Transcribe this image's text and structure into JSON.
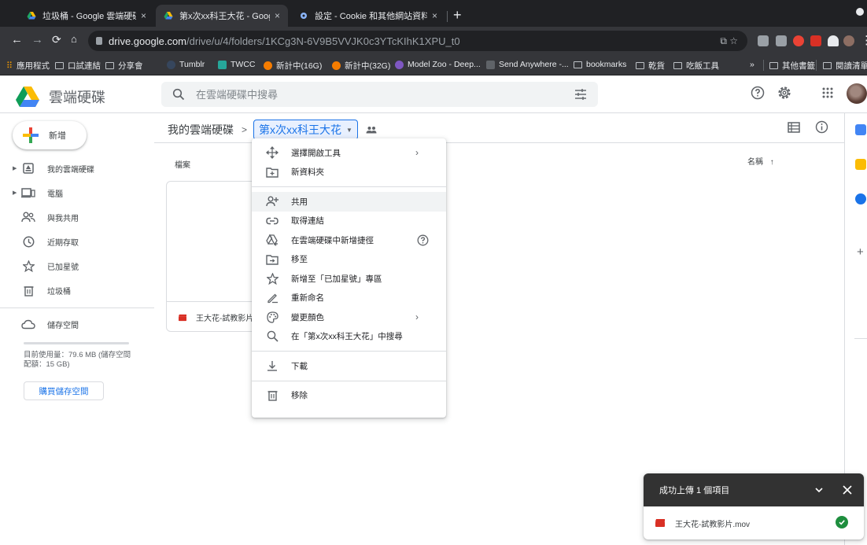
{
  "browser": {
    "tabs": [
      {
        "title": "垃圾桶 - Google 雲端硬碟",
        "close": "×"
      },
      {
        "title": "第x次xx科王大花 - Google 雲端",
        "close": "×"
      },
      {
        "title": "設定 - Cookie 和其他網站資料",
        "close": "×"
      }
    ],
    "new_tab": "+",
    "url_host": "drive.google.com",
    "url_path": "/drive/u/4/folders/1KCg3N-6V9B5VVJK0c3YTcKIhK1XPU_t0",
    "url_actions": "⧉  ☆"
  },
  "bookmarks": {
    "items": [
      "應用程式",
      "口試連結",
      "分享會",
      "Tumblr",
      "TWCC",
      "新計中(16G)",
      "新計中(32G)",
      "Model Zoo - Deep...",
      "Send Anywhere -...",
      "bookmarks",
      "乾貨",
      "吃飯工具"
    ],
    "more": "»",
    "other": "其他書籤",
    "reading": "閱讀清單"
  },
  "header": {
    "app_name": "雲端硬碟",
    "search_placeholder": "在雲端硬碟中搜尋"
  },
  "nav": {
    "new_label": "新增",
    "items": [
      {
        "label": "我的雲端硬碟",
        "icon": "my-drive-icon"
      },
      {
        "label": "電腦",
        "icon": "computer-icon"
      },
      {
        "label": "與我共用",
        "icon": "shared-icon"
      },
      {
        "label": "近期存取",
        "icon": "clock-icon"
      },
      {
        "label": "已加星號",
        "icon": "star-icon"
      },
      {
        "label": "垃圾桶",
        "icon": "trash-icon"
      }
    ],
    "storage_label": "儲存空間",
    "storage_text": "目前使用量：79.6 MB (儲存空間配額：15 GB)",
    "buy_storage": "購買儲存空間"
  },
  "breadcrumb": {
    "root": "我的雲端硬碟",
    "separator": ">",
    "current": "第x次xx科王大花"
  },
  "main": {
    "files_label": "檔案",
    "sort_label": "名稱",
    "sort_arrow": "↑",
    "file_name": "王大花-試教影片.mov"
  },
  "context_menu": {
    "items": [
      {
        "label": "選擇開啟工具",
        "icon": "open-with-icon",
        "arrow": "›"
      },
      {
        "label": "新資料夾",
        "icon": "new-folder-icon"
      },
      {
        "label": "共用",
        "icon": "share-icon"
      },
      {
        "label": "取得連結",
        "icon": "link-icon"
      },
      {
        "label": "在雲端硬碟中新增捷徑",
        "icon": "add-shortcut-icon"
      },
      {
        "label": "移至",
        "icon": "move-to-icon"
      },
      {
        "label": "新增至「已加星號」專區",
        "icon": "star-icon"
      },
      {
        "label": "重新命名",
        "icon": "rename-icon"
      },
      {
        "label": "變更顏色",
        "icon": "palette-icon",
        "arrow": "›"
      },
      {
        "label": "在「第x次xx科王大花」中搜尋",
        "icon": "search-icon"
      },
      {
        "label": "下載",
        "icon": "download-icon"
      },
      {
        "label": "移除",
        "icon": "trash-icon"
      }
    ],
    "highlighted": "共用"
  },
  "upload_toast": {
    "title": "成功上傳 1 個項目",
    "file_name": "王大花-試教影片.mov"
  },
  "colors": {
    "accent": "#1a73e8",
    "video_red": "#d93025",
    "success": "#1e8e3e",
    "toast_bg": "#323232"
  }
}
